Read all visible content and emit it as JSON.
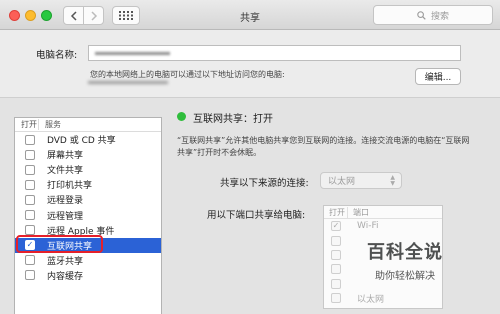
{
  "window": {
    "title": "共享"
  },
  "search": {
    "placeholder": "搜索"
  },
  "computer_name": {
    "label": "电脑名称:",
    "hint": "您的本地网络上的电脑可以通过以下地址访问您的电脑:",
    "edit_label": "编辑..."
  },
  "services": {
    "header_on": "打开",
    "header_service": "服务",
    "items": [
      {
        "label": "DVD 或 CD 共享",
        "checked": false
      },
      {
        "label": "屏幕共享",
        "checked": false
      },
      {
        "label": "文件共享",
        "checked": false
      },
      {
        "label": "打印机共享",
        "checked": false
      },
      {
        "label": "远程登录",
        "checked": false
      },
      {
        "label": "远程管理",
        "checked": false
      },
      {
        "label": "远程 Apple 事件",
        "checked": false
      },
      {
        "label": "互联网共享",
        "checked": true,
        "selected": true
      },
      {
        "label": "蓝牙共享",
        "checked": false
      },
      {
        "label": "内容缓存",
        "checked": false
      }
    ],
    "check_glyph": "✓"
  },
  "detail": {
    "status": "互联网共享：打开",
    "status_color": "#2fbd3c",
    "description": "“互联网共享”允许其他电脑共享您到互联网的连接。连接交流电源的电脑在“互联网共享”打开时不会休眠。",
    "share_from_label": "共享以下来源的连接:",
    "share_from_value": "以太网",
    "share_to_label": "用以下端口共享给电脑:",
    "ports_header_on": "打开",
    "ports_header_port": "端口",
    "ports": [
      {
        "label": "Wi-Fi",
        "checked": true
      },
      {
        "label": "",
        "checked": false
      },
      {
        "label": "",
        "checked": false
      },
      {
        "label": "",
        "checked": false
      },
      {
        "label": "",
        "checked": false
      },
      {
        "label": "以太网",
        "checked": false
      }
    ]
  },
  "watermark": {
    "title": "百科全说",
    "subtitle": "助你轻松解决"
  },
  "accent_color": "#2b62d6",
  "highlight_color": "#e5202a"
}
